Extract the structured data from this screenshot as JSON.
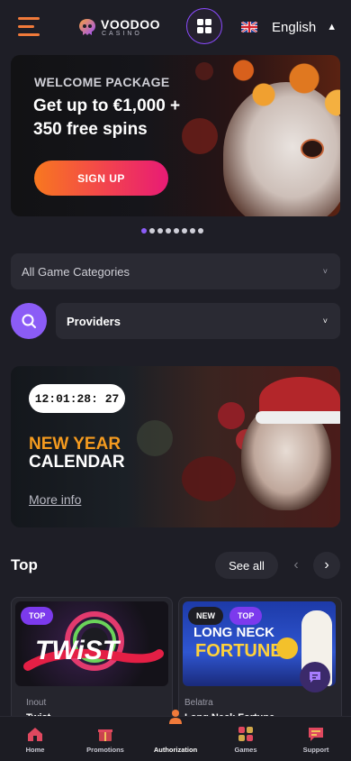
{
  "header": {
    "logo_text": "VOODOO",
    "logo_sub": "CASINO",
    "language": "English",
    "language_flag": "uk-flag-icon"
  },
  "hero": {
    "kicker": "WELCOME PACKAGE",
    "title": "Get up to €1,000 + 350 free spins",
    "cta": "SIGN UP",
    "slides_total": 8,
    "active_slide": 1
  },
  "filters": {
    "categories": "All Game Categories",
    "providers": "Providers"
  },
  "calendar_promo": {
    "timer": "12:01:28: 27",
    "title_line1": "NEW YEAR",
    "title_line2": "CALENDAR",
    "link": "More info"
  },
  "top_section": {
    "title": "Top",
    "see_all": "See all",
    "games": [
      {
        "badge": "TOP",
        "provider": "Inout",
        "name": "Twist",
        "art_title": "TWiST"
      },
      {
        "badges": [
          "NEW",
          "TOP"
        ],
        "provider": "Belatra",
        "name": "Long Neck Fortune",
        "art_title_1": "LONG NECK",
        "art_title_2": "FORTUNE"
      }
    ]
  },
  "bottom_nav": {
    "items": [
      {
        "label": "Home",
        "icon": "home-icon"
      },
      {
        "label": "Promotions",
        "icon": "gift-icon"
      },
      {
        "label": "Authorization",
        "icon": "user-icon"
      },
      {
        "label": "Games",
        "icon": "games-icon"
      },
      {
        "label": "Support",
        "icon": "chat-icon"
      }
    ],
    "active": "Authorization"
  },
  "colors": {
    "background": "#1e1e26",
    "accent_purple": "#8b5cf6",
    "accent_orange": "#f17a3a",
    "cta_gradient": [
      "#f8781f",
      "#e81b75"
    ]
  }
}
